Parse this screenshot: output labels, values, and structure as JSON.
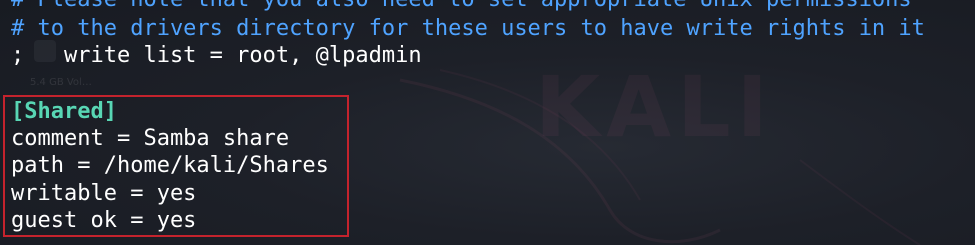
{
  "terminal": {
    "background_watermark": "KALI",
    "background_small_label": "5.4 GB Vol…"
  },
  "lines": {
    "comment1": "# Please note that you also need to set appropriate Unix permissions",
    "comment2": "# to the drivers directory for these users to have write rights in it",
    "writelist": ";   write list = root, @lpadmin",
    "section": "[Shared]",
    "l1": "comment = Samba share",
    "l2": "path = /home/kali/Shares",
    "l3": "writable = yes",
    "l4": "guest ok = yes"
  },
  "colors": {
    "comment": "#4fa3ff",
    "section_header": "#58d6b4",
    "highlight_border": "#c4232d",
    "text": "#ffffff",
    "background": "#1b1e26"
  }
}
